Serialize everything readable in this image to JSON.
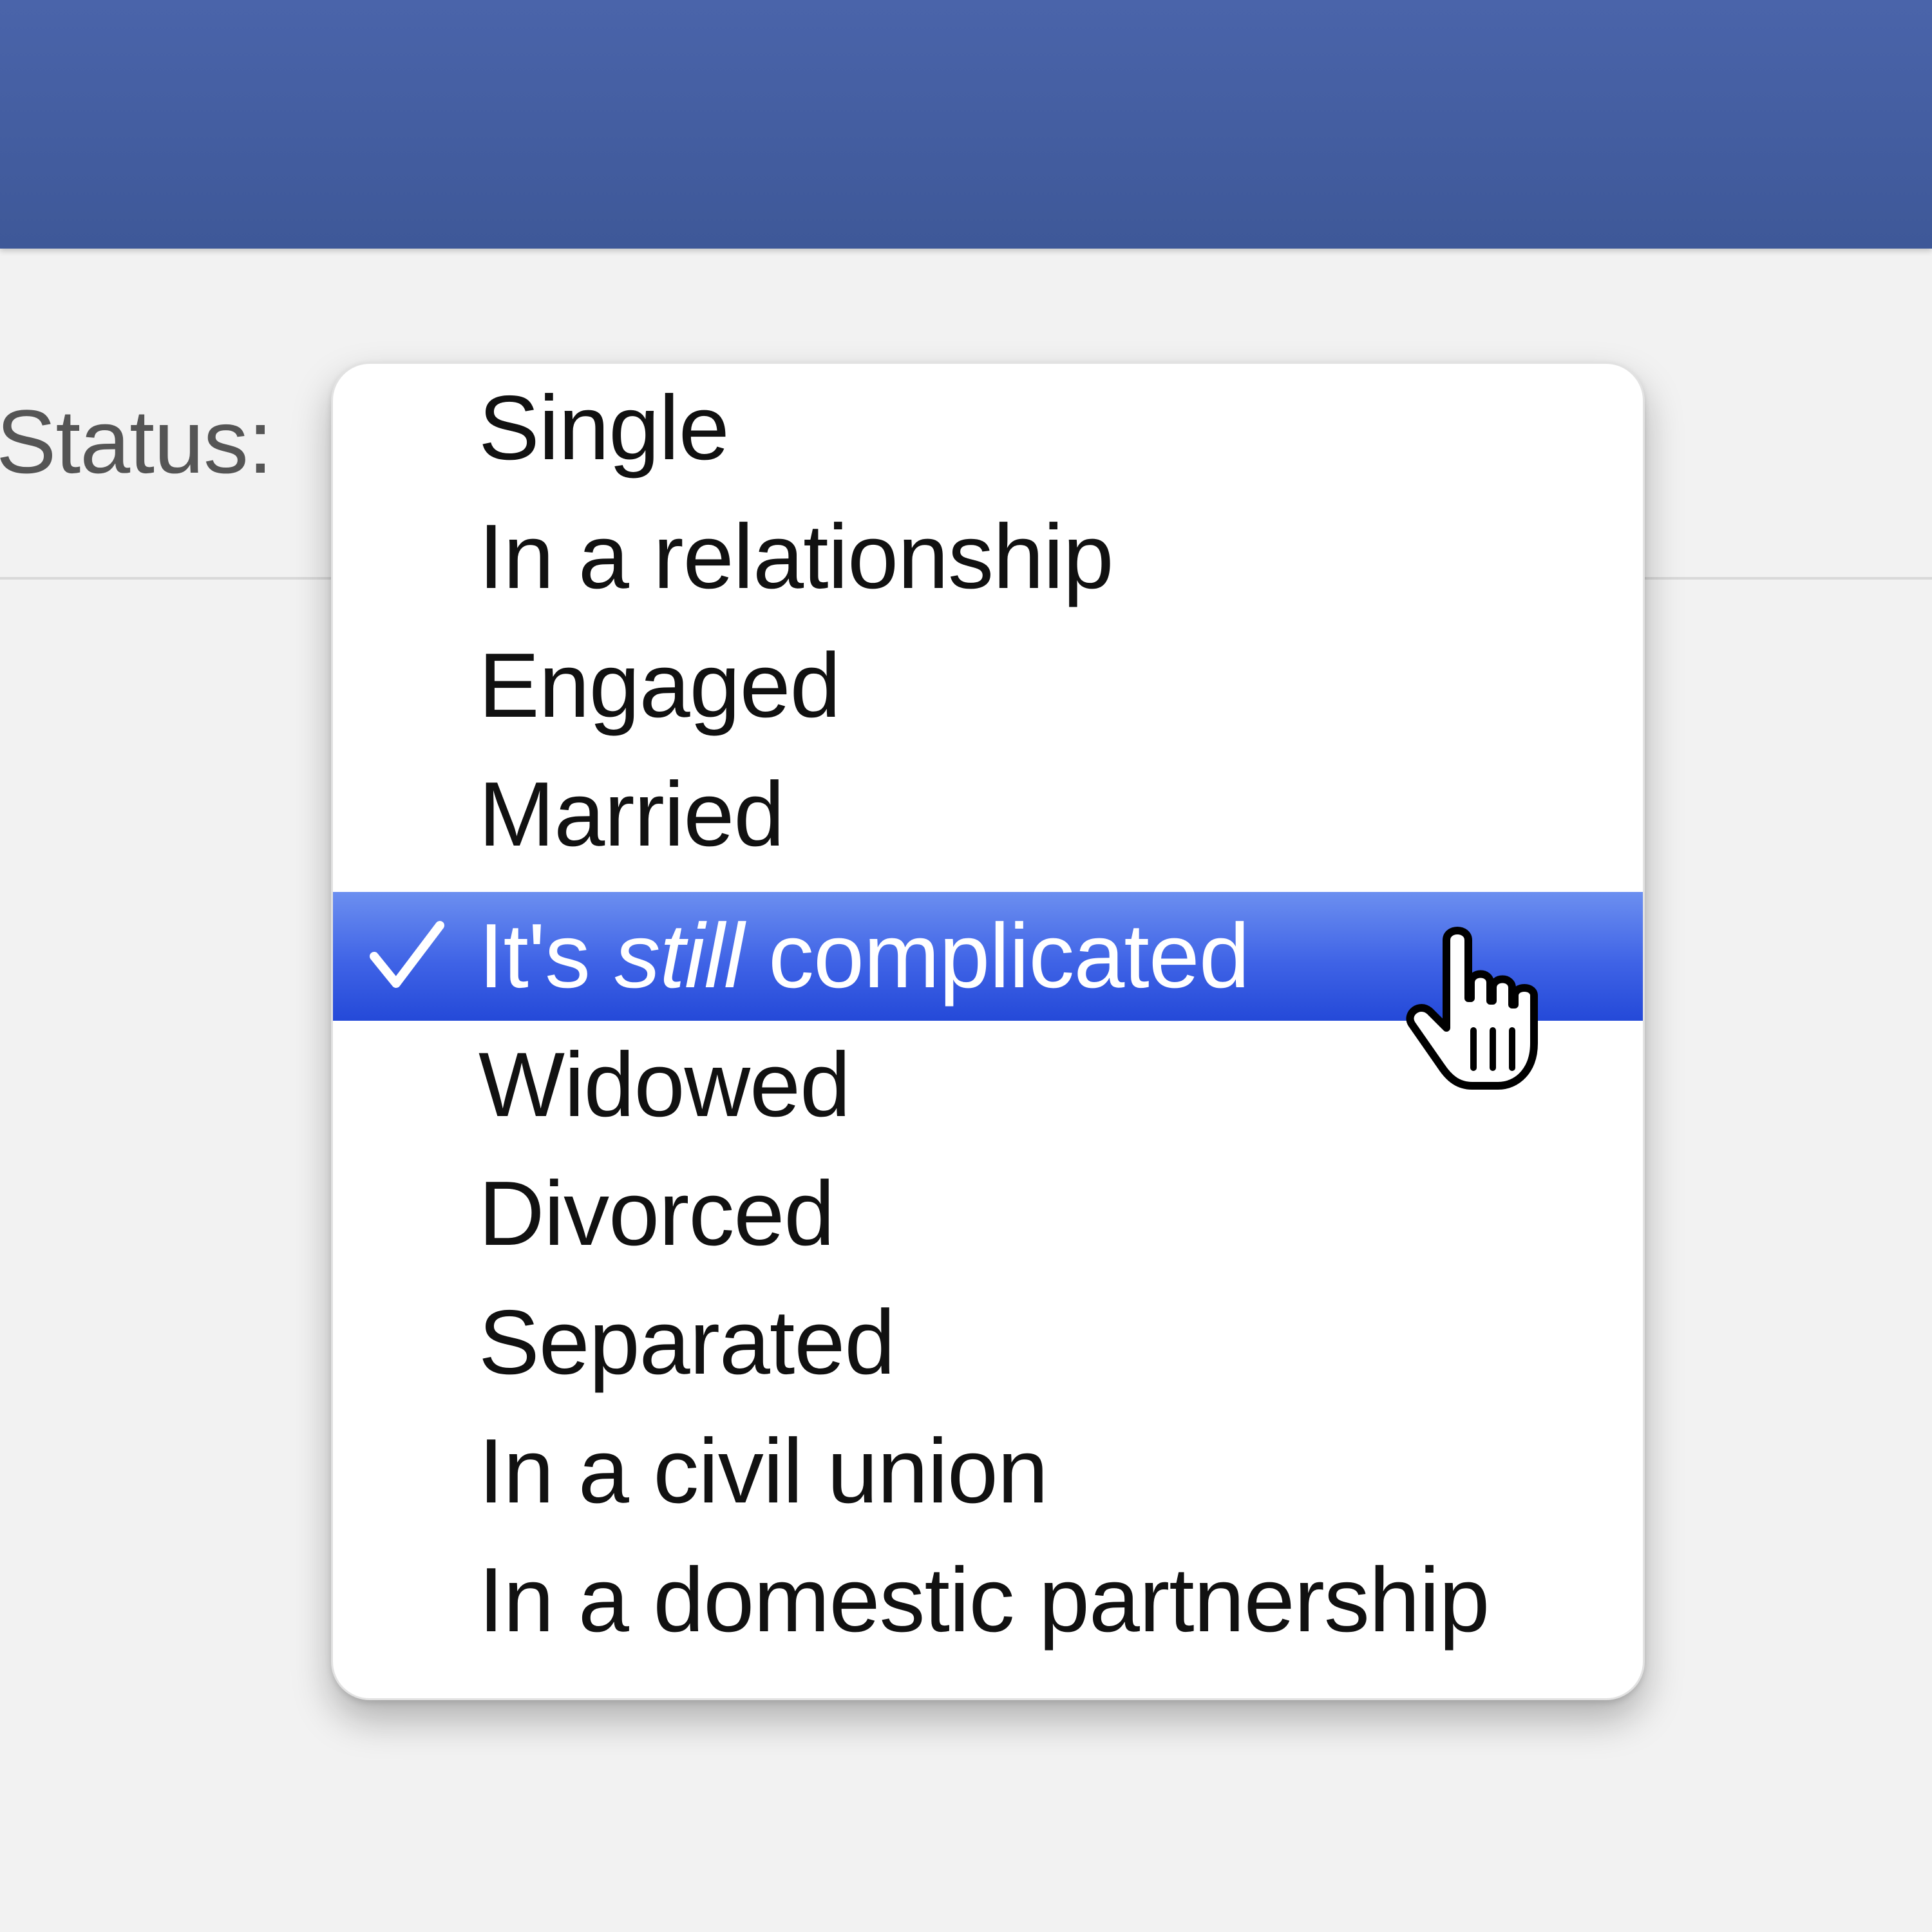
{
  "header": {
    "color": "#4a64aa"
  },
  "form": {
    "status_label": "Status:"
  },
  "dropdown": {
    "selected_index": 4,
    "options": [
      {
        "label": "Single"
      },
      {
        "label": "In a relationship"
      },
      {
        "label": "Engaged"
      },
      {
        "label": "Married"
      },
      {
        "label_pre": "It's ",
        "label_em": "still",
        "label_post": " complicated"
      },
      {
        "label": "Widowed"
      },
      {
        "label": "Divorced"
      },
      {
        "label": "Separated"
      },
      {
        "label": "In a civil union"
      },
      {
        "label": "In a domestic partnership"
      }
    ],
    "selected_color": "#3f63e6",
    "check_icon": "checkmark-icon"
  },
  "cursor": {
    "icon": "hand-pointer-icon"
  }
}
